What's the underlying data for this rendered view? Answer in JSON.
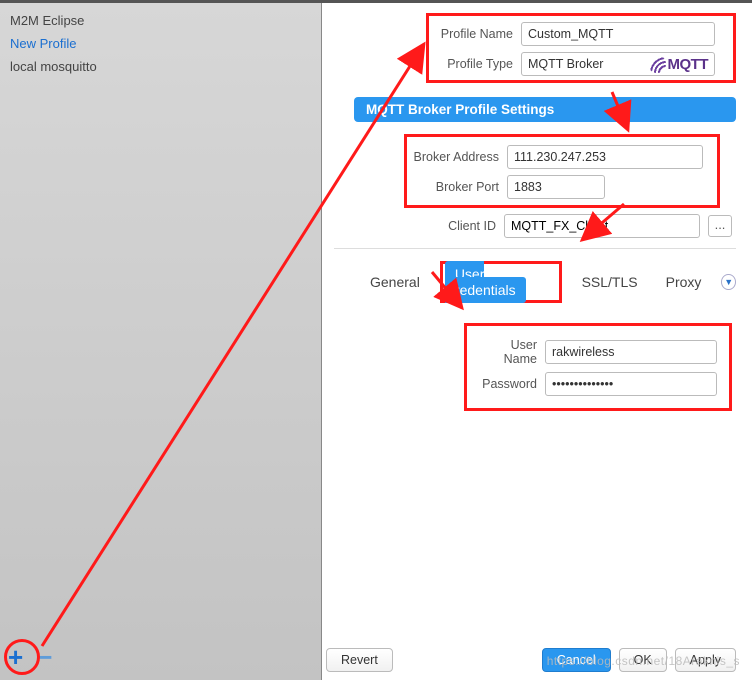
{
  "sidebar": {
    "items": [
      {
        "label": "M2M Eclipse",
        "selected": false
      },
      {
        "label": "New Profile",
        "selected": true
      },
      {
        "label": "local mosquitto",
        "selected": false
      }
    ]
  },
  "profile": {
    "name_label": "Profile Name",
    "name_value": "Custom_MQTT",
    "type_label": "Profile Type",
    "type_value": "MQTT Broker",
    "logo_text": "MQTT"
  },
  "settings": {
    "header": "MQTT Broker Profile Settings",
    "broker_address_label": "Broker Address",
    "broker_address_value": "111.230.247.253",
    "broker_port_label": "Broker Port",
    "broker_port_value": "1883",
    "client_id_label": "Client ID",
    "client_id_value": "MQTT_FX_Client",
    "generate_label": "..."
  },
  "tabs": {
    "general": "General",
    "user_credentials": "User Credentials",
    "ssl_tls": "SSL/TLS",
    "proxy": "Proxy"
  },
  "credentials": {
    "username_label": "User Name",
    "username_value": "rakwireless",
    "password_label": "Password",
    "password_value": "••••••••••••••"
  },
  "footer": {
    "revert": "Revert",
    "cancel": "Cancel",
    "ok": "OK",
    "apply": "Apply"
  },
  "watermark": "https://blog.csdn.net/18Araknis_s",
  "colors": {
    "annotation": "#ff1a1a",
    "accent": "#2a97ef"
  }
}
